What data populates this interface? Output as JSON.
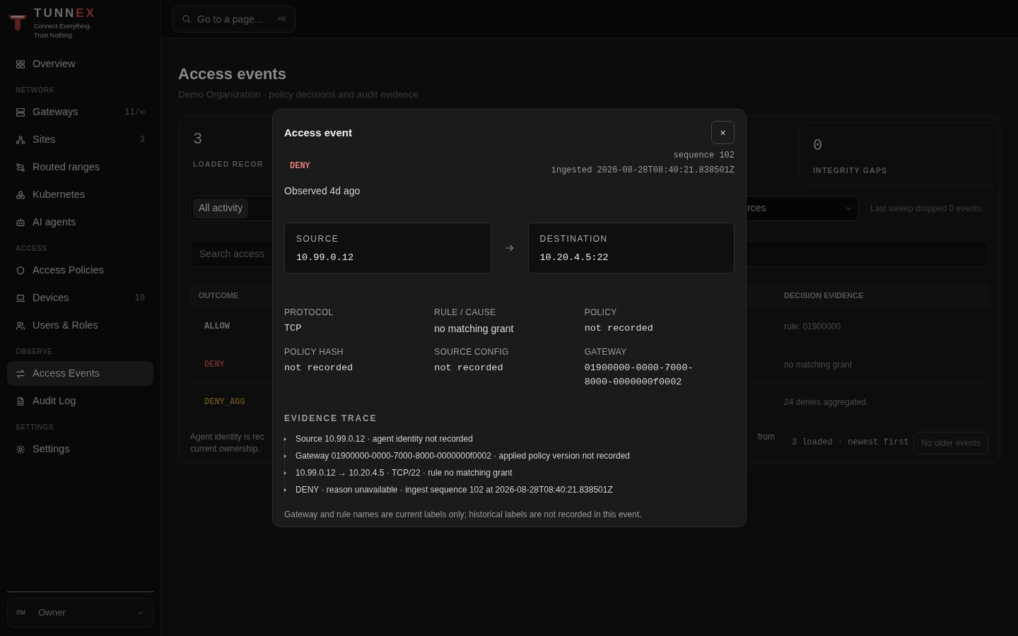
{
  "brand": {
    "parts": [
      {
        "text": "TUNN",
        "accent": false
      },
      {
        "text": "EX",
        "accent": true
      }
    ],
    "tagline": [
      "Connect Everything.",
      "Trust Nothing."
    ]
  },
  "sidebar": {
    "sections": [
      {
        "items": [
          {
            "label": "Overview",
            "selected": false
          }
        ]
      },
      {
        "label": "NETWORK",
        "items": [
          {
            "label": "Gateways",
            "count": "11/∞",
            "selected": false
          },
          {
            "label": "Sites",
            "count": "3",
            "selected": false
          },
          {
            "label": "Routed ranges",
            "selected": false
          },
          {
            "label": "Kubernetes",
            "selected": false
          },
          {
            "label": "AI agents",
            "selected": false
          }
        ]
      },
      {
        "label": "ACCESS",
        "items": [
          {
            "label": "Access Policies",
            "selected": false
          },
          {
            "label": "Devices",
            "count": "10",
            "selected": false
          },
          {
            "label": "Users & Roles",
            "selected": false
          }
        ]
      },
      {
        "label": "OBSERVE",
        "items": [
          {
            "label": "Access Events",
            "selected": true
          },
          {
            "label": "Audit Log",
            "selected": false
          }
        ]
      },
      {
        "label": "SETTINGS",
        "items": [
          {
            "label": "Settings",
            "selected": false
          }
        ]
      }
    ],
    "user": {
      "initials": "OW",
      "name": "Owner"
    }
  },
  "topbar": {
    "placeholder": "Go to a page...",
    "shortcut": "⌘K"
  },
  "page": {
    "title": "Access events",
    "subtitle": "Demo Organization · policy decisions and audit evidence"
  },
  "stats": [
    {
      "value": "3",
      "label": "LOADED RECOR"
    },
    {
      "value": "0",
      "label": "INTEGRITY GAPS"
    }
  ],
  "filters": {
    "tabs": [
      {
        "label": "All activity",
        "selected": true
      }
    ],
    "select_value": "rces",
    "note": "Last sweep dropped 0 events."
  },
  "search": {
    "placeholder": "Search access"
  },
  "table": {
    "columns": [
      "OUTCOME",
      "DECISION EVIDENCE"
    ],
    "rows": [
      {
        "outcome": "ALLOW",
        "kind": "allow",
        "evidence": "rule: 01900000"
      },
      {
        "outcome": "DENY",
        "kind": "deny",
        "evidence": "no matching grant"
      },
      {
        "outcome": "DENY_AGG",
        "kind": "deny_agg",
        "evidence": "24 denies aggregated"
      }
    ]
  },
  "footer": {
    "note": [
      "Agent identity is rec",
      "current ownership."
    ],
    "note_tail": "from",
    "count": "3 loaded · newest first",
    "button": "No older events"
  },
  "modal": {
    "title": "Access event",
    "close": "×",
    "outcome": "DENY",
    "observed": "Observed 4d ago",
    "sequence": "sequence 102",
    "ingested": "ingested 2026-08-28T08:40:21.838501Z",
    "source": {
      "label": "SOURCE",
      "value": "10.99.0.12"
    },
    "destination": {
      "label": "DESTINATION",
      "value": "10.20.4.5:22"
    },
    "fields": [
      {
        "label": "PROTOCOL",
        "value": "TCP",
        "kind": "mono"
      },
      {
        "label": "RULE / CAUSE",
        "value": "no matching grant",
        "kind": "text"
      },
      {
        "label": "POLICY",
        "value": "not recorded",
        "kind": "mono"
      },
      {
        "label": "POLICY HASH",
        "value": "not recorded",
        "kind": "mono"
      },
      {
        "label": "SOURCE CONFIG",
        "value": "not recorded",
        "kind": "mono"
      },
      {
        "label": "GATEWAY",
        "value": "01900000-0000-7000-8000-0000000f0002",
        "kind": "mono"
      }
    ],
    "trace_title": "EVIDENCE TRACE",
    "trace": [
      "Source 10.99.0.12 · agent identity not recorded",
      "Gateway 01900000-0000-7000-8000-0000000f0002 · applied policy version not recorded",
      "10.99.0.12 → 10.20.4.5 · TCP/22 · rule no matching grant",
      "DENY · reason unavailable · ingest sequence 102 at 2026-08-28T08:40:21.838501Z"
    ],
    "note": "Gateway and rule names are current labels only; historical labels are not recorded in this event."
  }
}
